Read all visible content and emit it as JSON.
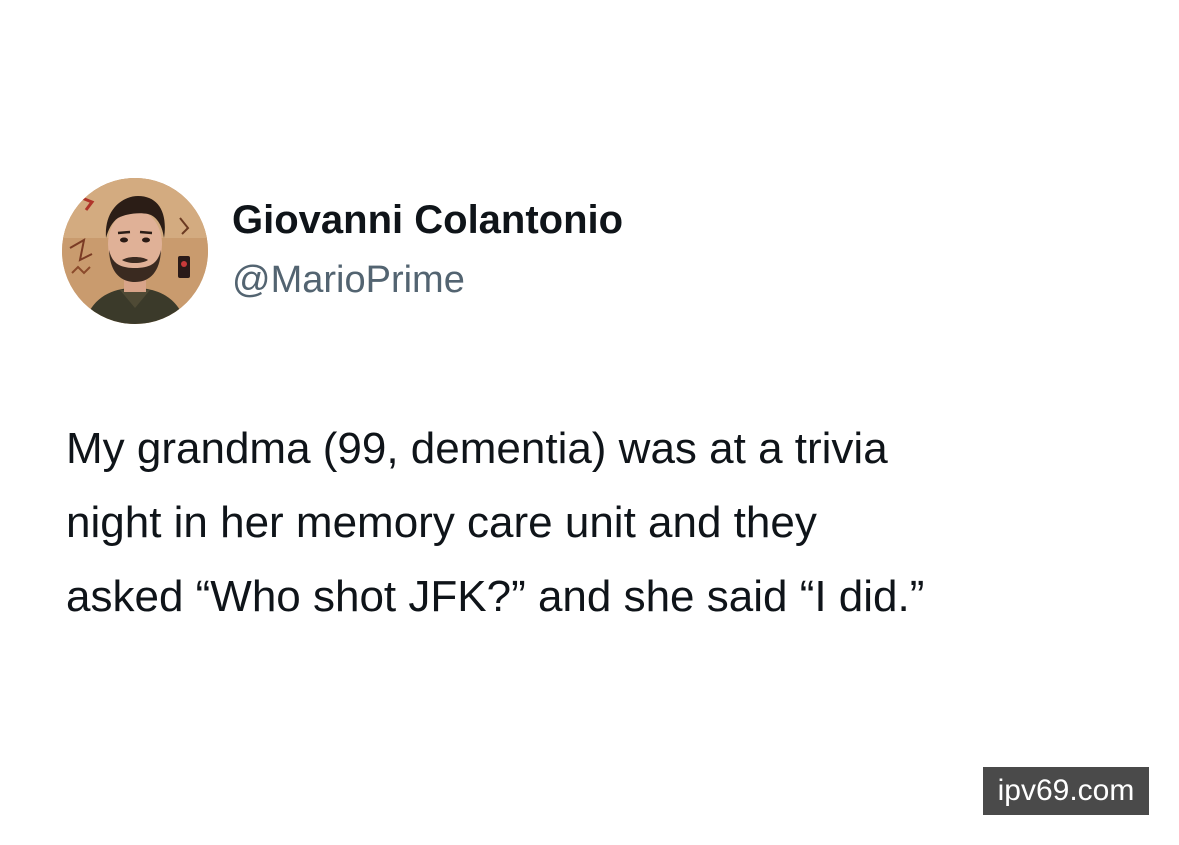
{
  "tweet": {
    "author": {
      "display_name": "Giovanni Colantonio",
      "handle": "@MarioPrime"
    },
    "text_lines": [
      "My grandma (99, dementia) was at a trivia",
      "night in her memory care unit and they",
      "asked “Who shot JFK?” and she said “I did.”"
    ]
  },
  "watermark": {
    "text": "ipv69.com"
  },
  "colors": {
    "name": "#0f1419",
    "handle": "#536471",
    "body_text": "#0f1419",
    "watermark_bg": "#4a4a4a",
    "watermark_text": "#ffffff"
  }
}
